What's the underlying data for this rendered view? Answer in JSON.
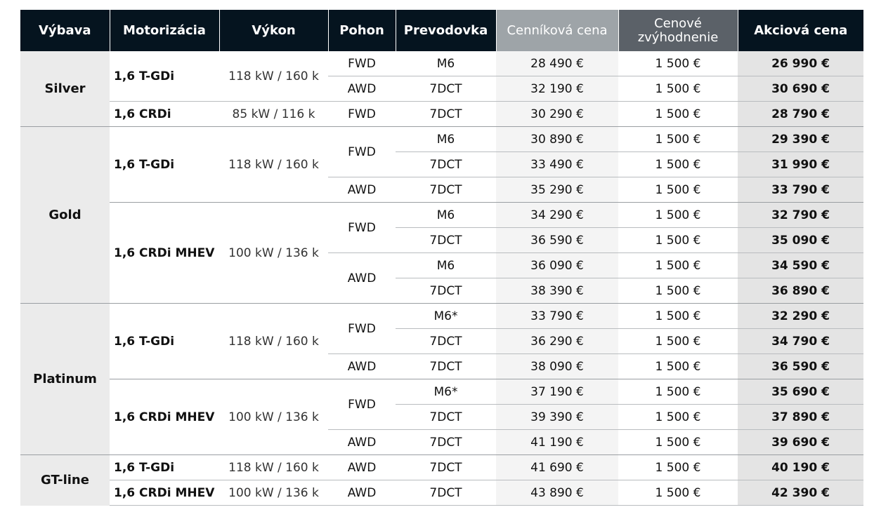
{
  "headers": {
    "trim": "Výbava",
    "engine": "Motorizácia",
    "power": "Výkon",
    "drive": "Pohon",
    "gearbox": "Prevodovka",
    "list_price": "Cenníková cena",
    "discount": "Cenové zvýhodnenie",
    "promo_price": "Akciová cena"
  },
  "trims": {
    "silver": "Silver",
    "gold": "Gold",
    "platinum": "Platinum",
    "gtline": "GT-line"
  },
  "engines": {
    "tgdi": "1,6 T-GDi",
    "crdi": "1,6 CRDi",
    "mhev": "1,6 CRDi MHEV"
  },
  "powers": {
    "p118": "118 kW / 160 k",
    "p85": "85 kW / 116 k",
    "p100": "100 kW / 136 k"
  },
  "drives": {
    "fwd": "FWD",
    "awd": "AWD"
  },
  "rows": [
    {
      "gearbox": "M6",
      "list": "28 490 €",
      "discount": "1 500 €",
      "promo": "26 990 €"
    },
    {
      "gearbox": "7DCT",
      "list": "32 190 €",
      "discount": "1 500 €",
      "promo": "30 690 €"
    },
    {
      "gearbox": "7DCT",
      "list": "30 290 €",
      "discount": "1 500 €",
      "promo": "28 790 €"
    },
    {
      "gearbox": "M6",
      "list": "30 890 €",
      "discount": "1 500 €",
      "promo": "29 390 €"
    },
    {
      "gearbox": "7DCT",
      "list": "33 490 €",
      "discount": "1 500 €",
      "promo": "31 990 €"
    },
    {
      "gearbox": "7DCT",
      "list": "35 290 €",
      "discount": "1 500 €",
      "promo": "33 790 €"
    },
    {
      "gearbox": "M6",
      "list": "34 290 €",
      "discount": "1 500 €",
      "promo": "32 790 €"
    },
    {
      "gearbox": "7DCT",
      "list": "36 590 €",
      "discount": "1 500 €",
      "promo": "35 090 €"
    },
    {
      "gearbox": "M6",
      "list": "36 090 €",
      "discount": "1 500 €",
      "promo": "34 590 €"
    },
    {
      "gearbox": "7DCT",
      "list": "38 390 €",
      "discount": "1 500 €",
      "promo": "36 890 €"
    },
    {
      "gearbox": "M6*",
      "list": "33 790 €",
      "discount": "1 500 €",
      "promo": "32 290 €"
    },
    {
      "gearbox": "7DCT",
      "list": "36 290 €",
      "discount": "1 500 €",
      "promo": "34 790 €"
    },
    {
      "gearbox": "7DCT",
      "list": "38 090 €",
      "discount": "1 500 €",
      "promo": "36 590 €"
    },
    {
      "gearbox": "M6*",
      "list": "37 190 €",
      "discount": "1 500 €",
      "promo": "35 690 €"
    },
    {
      "gearbox": "7DCT",
      "list": "39 390 €",
      "discount": "1 500 €",
      "promo": "37 890 €"
    },
    {
      "gearbox": "7DCT",
      "list": "41 190 €",
      "discount": "1 500 €",
      "promo": "39 690 €"
    },
    {
      "gearbox": "7DCT",
      "list": "41 690 €",
      "discount": "1 500 €",
      "promo": "40 190 €"
    },
    {
      "gearbox": "7DCT",
      "list": "43 890 €",
      "discount": "1 500 €",
      "promo": "42 390 €"
    }
  ]
}
